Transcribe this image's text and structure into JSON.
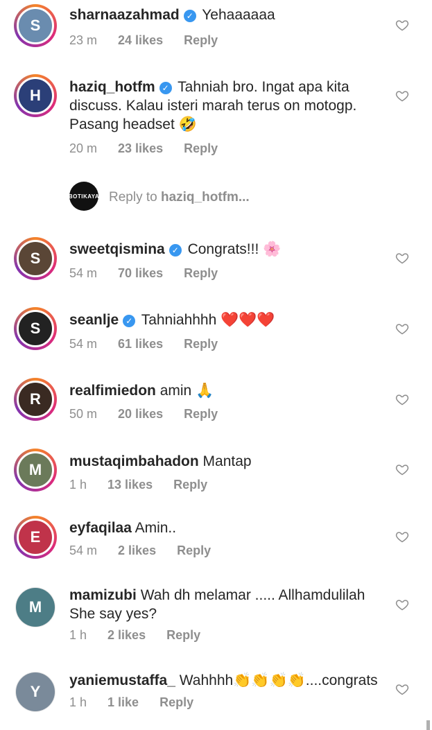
{
  "comments": [
    {
      "username": "sharnaazahmad",
      "verified": true,
      "text": "Yehaaaaaa",
      "time": "23 m",
      "likes": "24 likes",
      "reply": "Reply",
      "avatar_color": "#6a8caf",
      "avatar_initial": "S"
    },
    {
      "username": "haziq_hotfm",
      "verified": true,
      "text": "Tahniah bro. Ingat apa kita discuss. Kalau isteri marah terus on motogp. Pasang headset 🤣",
      "time": "20 m",
      "likes": "23 likes",
      "reply": "Reply",
      "avatar_color": "#2b3f78",
      "avatar_initial": "H"
    },
    {
      "username": "sweetqismina",
      "verified": true,
      "text": "Congrats!!! 🌸",
      "time": "54 m",
      "likes": "70 likes",
      "reply": "Reply",
      "avatar_color": "#5a4636",
      "avatar_initial": "S"
    },
    {
      "username": "seanlje",
      "verified": true,
      "text": "Tahniahhhh ❤️❤️❤️",
      "time": "54 m",
      "likes": "61 likes",
      "reply": "Reply",
      "avatar_color": "#222222",
      "avatar_initial": "S"
    },
    {
      "username": "realfimiedon",
      "verified": false,
      "text": "amin 🙏",
      "time": "50 m",
      "likes": "20 likes",
      "reply": "Reply",
      "avatar_color": "#3a2a22",
      "avatar_initial": "R"
    },
    {
      "username": "mustaqimbahadon",
      "verified": false,
      "text": "Mantap",
      "time": "1 h",
      "likes": "13 likes",
      "reply": "Reply",
      "avatar_color": "#6b7a5a",
      "avatar_initial": "M"
    },
    {
      "username": "eyfaqilaa",
      "verified": false,
      "text": "Amin..",
      "time": "54 m",
      "likes": "2 likes",
      "reply": "Reply",
      "avatar_color": "#c0334a",
      "avatar_initial": "E"
    },
    {
      "username": "mamizubi",
      "verified": false,
      "text": "Wah dh melamar ..... Allhamdulilah She say yes?",
      "time": "1 h",
      "likes": "2 likes",
      "reply": "Reply",
      "avatar_color": "#4d7d86",
      "avatar_initial": "M"
    },
    {
      "username": "yaniemustaffa_",
      "verified": false,
      "text": "Wahhhh👏👏👏👏....congrats",
      "time": "1 h",
      "likes": "1 like",
      "reply": "Reply",
      "avatar_color": "#7a8a9a",
      "avatar_initial": "Y"
    }
  ],
  "reply_prompt": {
    "prefix": "Reply to ",
    "username": "haziq_hotfm...",
    "avatar_label": "BOTIKAYA"
  },
  "icons": {
    "heart": "heart-outline-icon",
    "verified": "verified-badge-icon"
  },
  "colors": {
    "text": "#262626",
    "meta": "#8e8e8e",
    "verified": "#3897f0"
  }
}
